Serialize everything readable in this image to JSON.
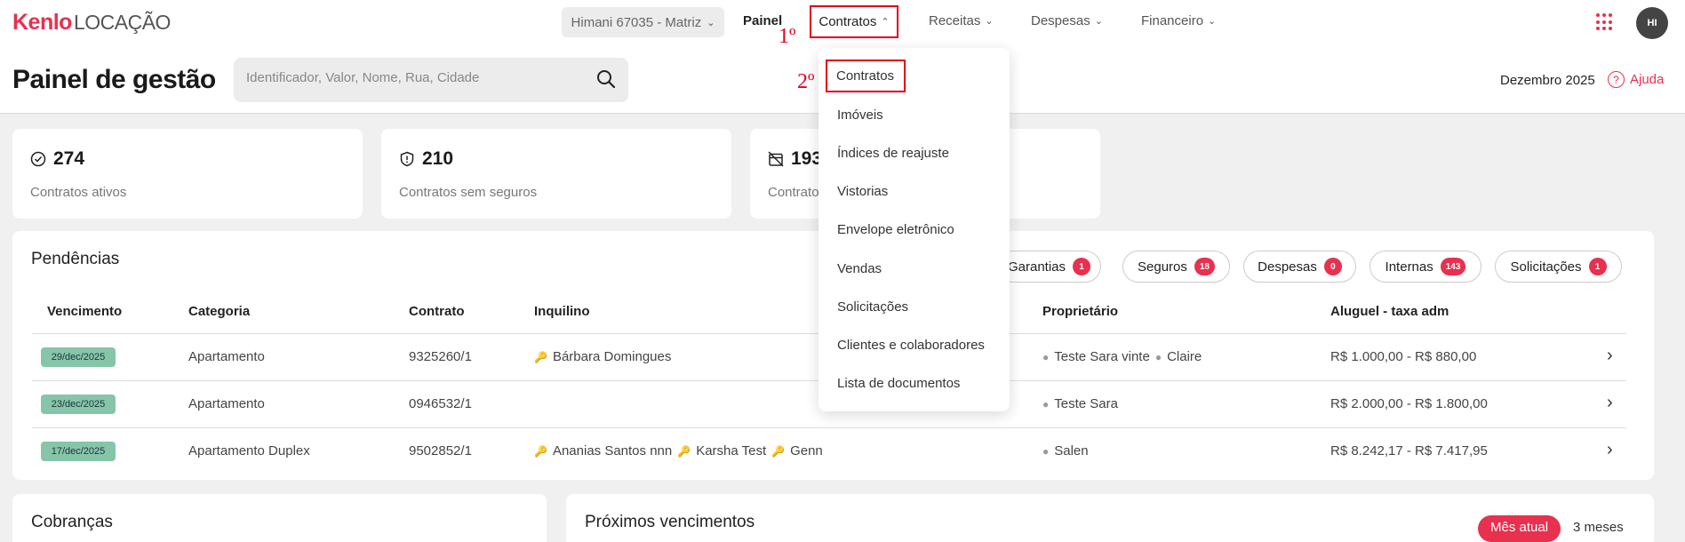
{
  "header": {
    "logo_brand": "Kenlo",
    "logo_product": "LOCAÇÃO",
    "branch": "Himani 67035 - Matriz",
    "nav": {
      "painel": "Painel",
      "contratos": "Contratos",
      "receitas": "Receitas",
      "despesas": "Despesas",
      "financeiro": "Financeiro"
    },
    "avatar_initials": "HI"
  },
  "annotations": {
    "step1": "1º",
    "step2": "2º"
  },
  "subheader": {
    "title": "Painel de gestão",
    "search_placeholder": "Identificador, Valor, Nome, Rua, Cidade",
    "month": "Dezembro 2025",
    "help": "Ajuda"
  },
  "stats": [
    {
      "value": "274",
      "label": "Contratos ativos",
      "icon": "check-circle-icon"
    },
    {
      "value": "210",
      "label": "Contratos sem seguros",
      "icon": "shield-icon"
    },
    {
      "value": "193",
      "label": "Contrato",
      "icon": "calendar-off-icon"
    }
  ],
  "dropdown": {
    "items": [
      "Contratos",
      "Imóveis",
      "Índices de reajuste",
      "Vistorias",
      "Envelope eletrônico",
      "Vendas",
      "Solicitações",
      "Clientes e colaboradores",
      "Lista de documentos"
    ]
  },
  "pendencias": {
    "title": "Pendências",
    "chips": [
      {
        "label": "Garantias",
        "count": "1"
      },
      {
        "label": "Seguros",
        "count": "18"
      },
      {
        "label": "Despesas",
        "count": "0"
      },
      {
        "label": "Internas",
        "count": "143"
      },
      {
        "label": "Solicitações",
        "count": "1"
      }
    ],
    "columns": [
      "Vencimento",
      "Categoria",
      "Contrato",
      "Inquilino",
      "Proprietário",
      "Aluguel - taxa adm"
    ],
    "rows": [
      {
        "date": "29/dec/2025",
        "category": "Apartamento",
        "contract": "9325260/1",
        "tenants": [
          "Bárbara Domingues"
        ],
        "owners": [
          "Teste Sara vinte",
          "Claire"
        ],
        "rent": "R$ 1.000,00 - R$ 880,00"
      },
      {
        "date": "23/dec/2025",
        "category": "Apartamento",
        "contract": "0946532/1",
        "tenants": [],
        "owners": [
          "Teste Sara"
        ],
        "rent": "R$ 2.000,00 - R$ 1.800,00"
      },
      {
        "date": "17/dec/2025",
        "category": "Apartamento Duplex",
        "contract": "9502852/1",
        "tenants": [
          "Ananias Santos nnn",
          "Karsha Test",
          "Genn"
        ],
        "owners": [
          "Salen"
        ],
        "rent": "R$ 8.242,17 - R$ 7.417,95"
      }
    ]
  },
  "cobrancas": {
    "title": "Cobranças"
  },
  "proximos": {
    "title": "Próximos vencimentos",
    "toggle_active": "Mês atual",
    "toggle_other": "3 meses"
  },
  "colors": {
    "brand": "#e8304f",
    "annotation": "#e0001b",
    "date_badge": "#86c5a8"
  }
}
